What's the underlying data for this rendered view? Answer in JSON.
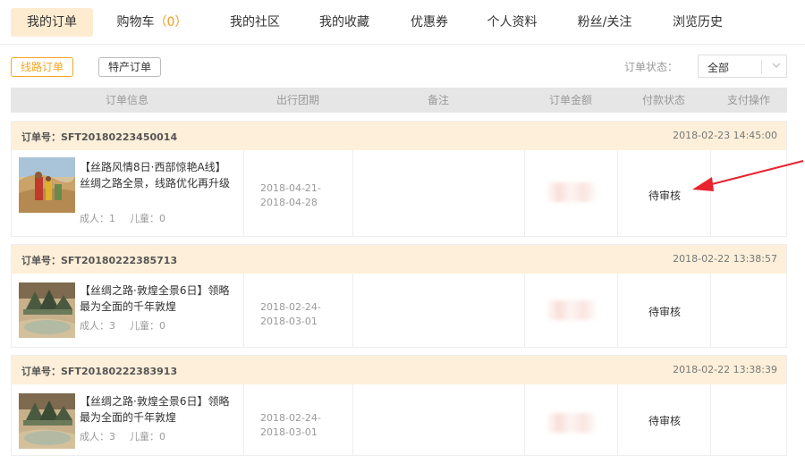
{
  "nav": {
    "items": [
      {
        "label": "我的订单"
      },
      {
        "label": "购物车"
      },
      {
        "label": "我的社区"
      },
      {
        "label": "我的收藏"
      },
      {
        "label": "优惠券"
      },
      {
        "label": "个人资料"
      },
      {
        "label": "粉丝/关注"
      },
      {
        "label": "浏览历史"
      }
    ],
    "cart_count_open": "（",
    "cart_count": "0",
    "cart_count_close": "）"
  },
  "subtabs": [
    {
      "label": "线路订单"
    },
    {
      "label": "特产订单"
    }
  ],
  "filter": {
    "label": "订单状态：",
    "selected": "全部"
  },
  "table": {
    "headers": [
      "订单信息",
      "出行团期",
      "备注",
      "订单金额",
      "付款状态",
      "支付操作"
    ]
  },
  "orders": [
    {
      "order_no_label": "订单号：SFT20180223450014",
      "time": "2018-02-23 14:45:00",
      "title": "【丝路风情8日·西部惊艳A线】丝绸之路全景，线路优化再升级",
      "adults": "成人：1",
      "children": "儿童：0",
      "date_start": "2018-04-21-",
      "date_end": "2018-04-28",
      "pay_status": "待审核"
    },
    {
      "order_no_label": "订单号：SFT20180222385713",
      "time": "2018-02-22 13:38:57",
      "title": "【丝绸之路·敦煌全景6日】领略最为全面的千年敦煌",
      "adults": "成人：3",
      "children": "儿童：0",
      "date_start": "2018-02-24-",
      "date_end": "2018-03-01",
      "pay_status": "待审核"
    },
    {
      "order_no_label": "订单号：SFT20180222383913",
      "time": "2018-02-22 13:38:39",
      "title": "【丝绸之路·敦煌全景6日】领略最为全面的千年敦煌",
      "adults": "成人：3",
      "children": "儿童：0",
      "date_start": "2018-02-24-",
      "date_end": "2018-03-01",
      "pay_status": "待审核"
    }
  ],
  "colors": {
    "accent": "#f5a623",
    "nav_active_bg": "#fdecd0",
    "order_head_bg": "#fdefd9",
    "arrow": "#e8232e"
  }
}
